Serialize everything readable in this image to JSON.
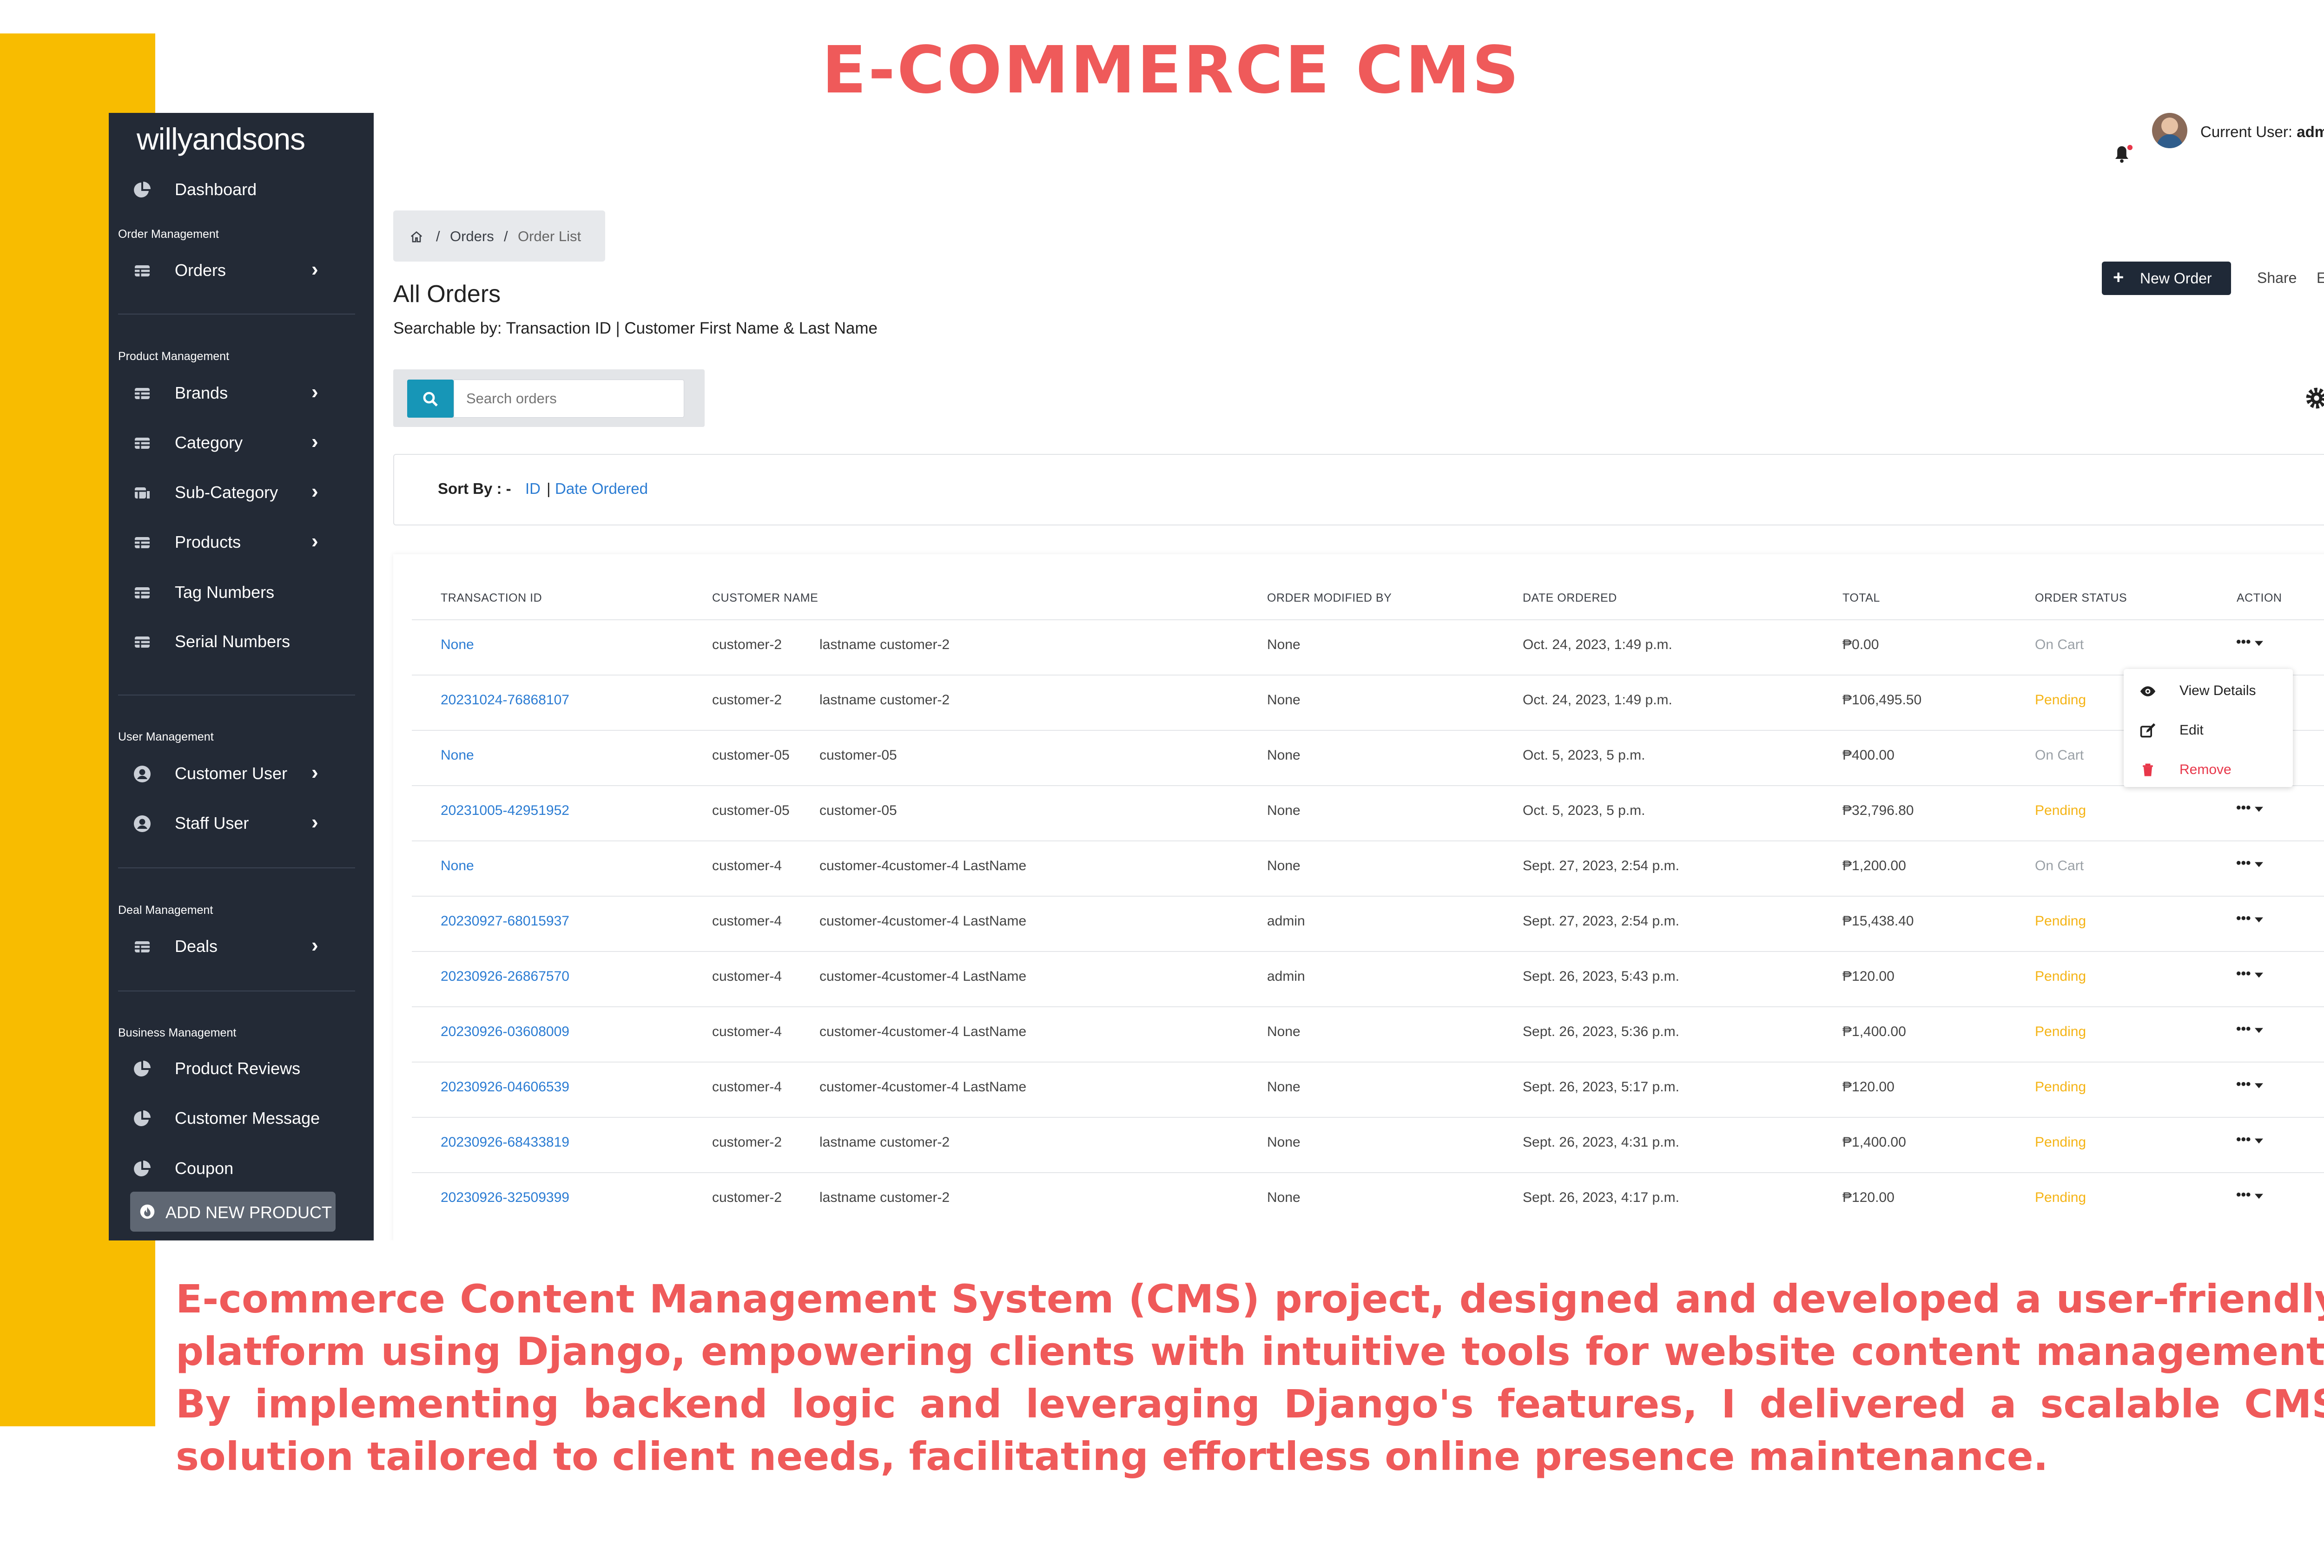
{
  "heading": "E-COMMERCE CMS",
  "description": "E-commerce Content Management System (CMS) project, designed and developed a user-friendly platform using Django, empowering clients with intuitive tools for website content management. By implementing backend logic and leveraging Django's features, I delivered a scalable CMS solution tailored to client needs, facilitating effortless online presence maintenance.",
  "colors": {
    "accent_red": "#ef5a5a",
    "yellow": "#f8bc00",
    "sidebar_bg": "#232a36",
    "link_blue": "#2b7cd3",
    "pending": "#f5b416"
  },
  "sidebar": {
    "brand": "willyandsons",
    "dashboard": "Dashboard",
    "sections": {
      "order": "Order Management",
      "product": "Product Management",
      "user": "User Management",
      "deal": "Deal Management",
      "business": "Business Management"
    },
    "items": {
      "orders": "Orders",
      "brands": "Brands",
      "category": "Category",
      "subcategory": "Sub-Category",
      "products": "Products",
      "tag_numbers": "Tag Numbers",
      "serial_numbers": "Serial Numbers",
      "customer_user": "Customer User",
      "staff_user": "Staff User",
      "deals": "Deals",
      "product_reviews": "Product Reviews",
      "customer_message": "Customer Message",
      "coupon": "Coupon"
    },
    "add_new_product": "ADD NEW PRODUCT"
  },
  "header": {
    "current_user_label": "Current User:",
    "current_user": "admin"
  },
  "breadcrumb": {
    "orders": "Orders",
    "sep": "/",
    "order_list": "Order List"
  },
  "page": {
    "title": "All Orders",
    "searchable": "Searchable by: Transaction ID | Customer First Name & Last Name",
    "new_order": "New Order",
    "share": "Share",
    "export": "Export"
  },
  "search": {
    "placeholder": "Search orders"
  },
  "sort": {
    "label": "Sort By : -",
    "id": "ID",
    "sep": "|",
    "date": "Date Ordered"
  },
  "table": {
    "headers": [
      "TRANSACTION ID",
      "CUSTOMER NAME",
      "ORDER MODIFIED BY",
      "DATE ORDERED",
      "TOTAL",
      "ORDER STATUS",
      "ACTION"
    ],
    "rows": [
      {
        "txn": "None",
        "first": "customer-2",
        "last": "lastname customer-2",
        "modified": "None",
        "date": "Oct. 24, 2023, 1:49 p.m.",
        "total": "₱0.00",
        "status": "On Cart"
      },
      {
        "txn": "20231024-76868107",
        "first": "customer-2",
        "last": "lastname customer-2",
        "modified": "None",
        "date": "Oct. 24, 2023, 1:49 p.m.",
        "total": "₱106,495.50",
        "status": "Pending"
      },
      {
        "txn": "None",
        "first": "customer-05",
        "last": "customer-05",
        "modified": "None",
        "date": "Oct. 5, 2023, 5 p.m.",
        "total": "₱400.00",
        "status": "On Cart"
      },
      {
        "txn": "20231005-42951952",
        "first": "customer-05",
        "last": "customer-05",
        "modified": "None",
        "date": "Oct. 5, 2023, 5 p.m.",
        "total": "₱32,796.80",
        "status": "Pending"
      },
      {
        "txn": "None",
        "first": "customer-4",
        "last": "customer-4customer-4 LastName",
        "modified": "None",
        "date": "Sept. 27, 2023, 2:54 p.m.",
        "total": "₱1,200.00",
        "status": "On Cart"
      },
      {
        "txn": "20230927-68015937",
        "first": "customer-4",
        "last": "customer-4customer-4 LastName",
        "modified": "admin",
        "date": "Sept. 27, 2023, 2:54 p.m.",
        "total": "₱15,438.40",
        "status": "Pending"
      },
      {
        "txn": "20230926-26867570",
        "first": "customer-4",
        "last": "customer-4customer-4 LastName",
        "modified": "admin",
        "date": "Sept. 26, 2023, 5:43 p.m.",
        "total": "₱120.00",
        "status": "Pending"
      },
      {
        "txn": "20230926-03608009",
        "first": "customer-4",
        "last": "customer-4customer-4 LastName",
        "modified": "None",
        "date": "Sept. 26, 2023, 5:36 p.m.",
        "total": "₱1,400.00",
        "status": "Pending"
      },
      {
        "txn": "20230926-04606539",
        "first": "customer-4",
        "last": "customer-4customer-4 LastName",
        "modified": "None",
        "date": "Sept. 26, 2023, 5:17 p.m.",
        "total": "₱120.00",
        "status": "Pending"
      },
      {
        "txn": "20230926-68433819",
        "first": "customer-2",
        "last": "lastname customer-2",
        "modified": "None",
        "date": "Sept. 26, 2023, 4:31 p.m.",
        "total": "₱1,400.00",
        "status": "Pending"
      },
      {
        "txn": "20230926-32509399",
        "first": "customer-2",
        "last": "lastname customer-2",
        "modified": "None",
        "date": "Sept. 26, 2023, 4:17 p.m.",
        "total": "₱120.00",
        "status": "Pending"
      }
    ],
    "action_glyph": "•••"
  },
  "action_menu": {
    "view": "View Details",
    "edit": "Edit",
    "remove": "Remove"
  }
}
